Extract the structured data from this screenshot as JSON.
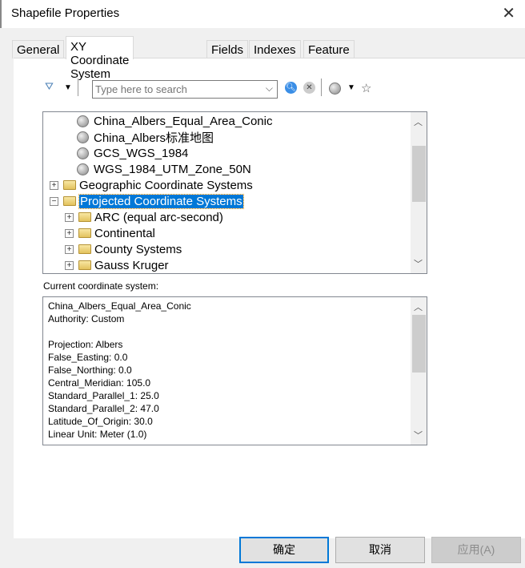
{
  "window": {
    "title": "Shapefile Properties",
    "close_icon": "close-icon"
  },
  "tabs": [
    {
      "label": "General"
    },
    {
      "label": "XY Coordinate System",
      "active": true
    },
    {
      "label": "Fields"
    },
    {
      "label": "Indexes"
    },
    {
      "label": "Feature Extent"
    }
  ],
  "toolbar": {
    "search_placeholder": "Type here to search",
    "filter_icon": "filter-icon",
    "search_icon": "search-icon",
    "clear_search_icon": "clear-search-icon",
    "globe_icon": "add-coordinate-system-icon",
    "favorite_icon": "add-to-favorites-icon"
  },
  "tree": {
    "items": [
      {
        "label": "China_Albers_Equal_Area_Conic",
        "type": "crs",
        "level": 2
      },
      {
        "label": "China_Albers标准地图",
        "type": "crs",
        "level": 2
      },
      {
        "label": "GCS_WGS_1984",
        "type": "crs",
        "level": 2
      },
      {
        "label": "WGS_1984_UTM_Zone_50N",
        "type": "crs",
        "level": 2
      },
      {
        "label": "Geographic Coordinate Systems",
        "type": "folder",
        "level": 0,
        "expanded": false
      },
      {
        "label": "Projected Coordinate Systems",
        "type": "folder",
        "level": 0,
        "expanded": true,
        "selected": true
      },
      {
        "label": "ARC (equal arc-second)",
        "type": "folder",
        "level": 1,
        "expanded": false
      },
      {
        "label": "Continental",
        "type": "folder",
        "level": 1,
        "expanded": false
      },
      {
        "label": "County Systems",
        "type": "folder",
        "level": 1,
        "expanded": false
      },
      {
        "label": "Gauss Kruger",
        "type": "folder",
        "level": 1,
        "expanded": false
      }
    ]
  },
  "current": {
    "label": "Current coordinate system:",
    "lines": [
      "China_Albers_Equal_Area_Conic",
      "Authority: Custom",
      "",
      "Projection: Albers",
      "False_Easting: 0.0",
      "False_Northing: 0.0",
      "Central_Meridian: 105.0",
      "Standard_Parallel_1: 25.0",
      "Standard_Parallel_2: 47.0",
      "Latitude_Of_Origin: 30.0",
      "Linear Unit: Meter (1.0)"
    ]
  },
  "buttons": {
    "ok": "确定",
    "cancel": "取消",
    "apply": "应用(A)"
  },
  "colors": {
    "selection": "#0078d7",
    "default_button_border": "#0078d7"
  }
}
